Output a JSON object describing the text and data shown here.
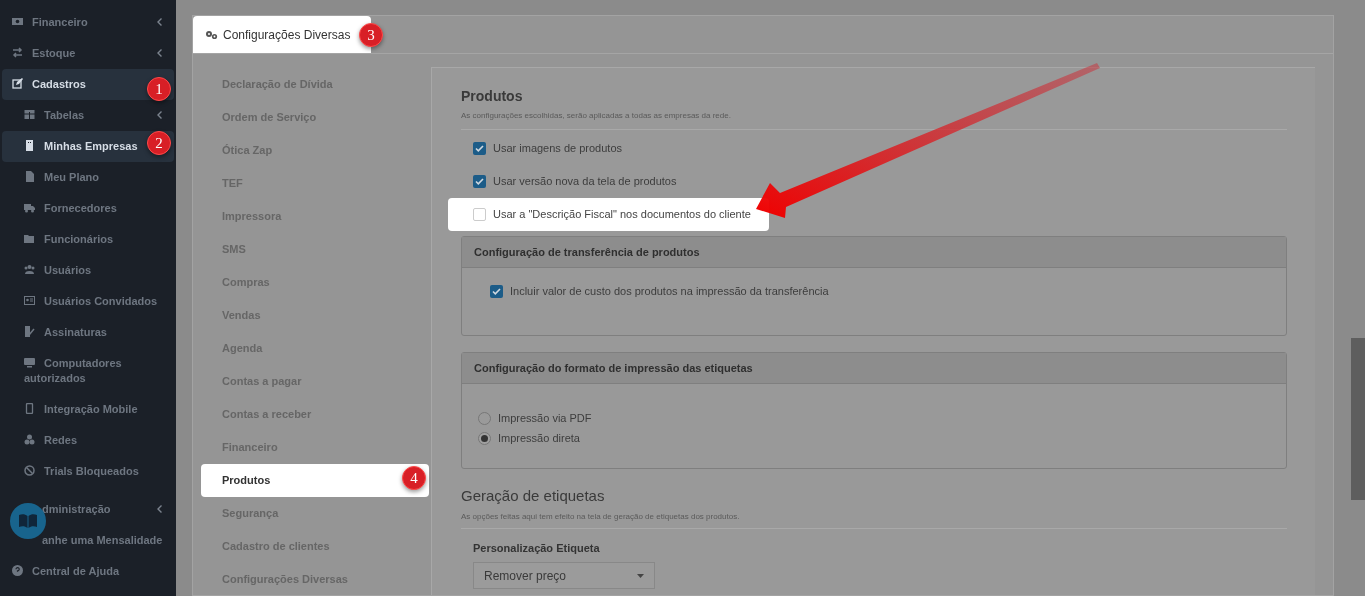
{
  "sidebar": {
    "items": [
      {
        "label": "Financeiro",
        "chevron": true,
        "selected": false
      },
      {
        "label": "Estoque",
        "chevron": true,
        "selected": false
      },
      {
        "label": "Cadastros",
        "chevron": false,
        "selected": true,
        "children": [
          {
            "label": "Tabelas",
            "chevron": true,
            "selected": false
          },
          {
            "label": "Minhas Empresas",
            "chevron": false,
            "selected": true
          },
          {
            "label": "Meu Plano",
            "chevron": false,
            "selected": false
          },
          {
            "label": "Fornecedores",
            "chevron": false,
            "selected": false
          },
          {
            "label": "Funcionários",
            "chevron": false,
            "selected": false
          },
          {
            "label": "Usuários",
            "chevron": false,
            "selected": false
          },
          {
            "label": "Usuários Convidados",
            "chevron": false,
            "selected": false
          },
          {
            "label": "Assinaturas",
            "chevron": false,
            "selected": false
          },
          {
            "label": "Computadores autorizados",
            "chevron": false,
            "selected": false
          },
          {
            "label": "Integração Mobile",
            "chevron": false,
            "selected": false
          },
          {
            "label": "Redes",
            "chevron": false,
            "selected": false
          },
          {
            "label": "Trials Bloqueados",
            "chevron": false,
            "selected": false
          }
        ]
      },
      {
        "label": "dministração",
        "chevron": true,
        "selected": false
      },
      {
        "label": "anhe uma Mensalidade",
        "chevron": false,
        "selected": false
      },
      {
        "label": "Central de Ajuda",
        "chevron": false,
        "selected": false
      }
    ]
  },
  "tab": {
    "label": "Configurações Diversas"
  },
  "settings_nav": {
    "items": [
      {
        "label": "Declaração de Dívida",
        "selected": false
      },
      {
        "label": "Ordem de Serviço",
        "selected": false
      },
      {
        "label": "Ótica Zap",
        "selected": false
      },
      {
        "label": "TEF",
        "selected": false
      },
      {
        "label": "Impressora",
        "selected": false
      },
      {
        "label": "SMS",
        "selected": false
      },
      {
        "label": "Compras",
        "selected": false
      },
      {
        "label": "Vendas",
        "selected": false
      },
      {
        "label": "Agenda",
        "selected": false
      },
      {
        "label": "Contas a pagar",
        "selected": false
      },
      {
        "label": "Contas a receber",
        "selected": false
      },
      {
        "label": "Financeiro",
        "selected": false
      },
      {
        "label": "Produtos",
        "selected": true
      },
      {
        "label": "Segurança",
        "selected": false
      },
      {
        "label": "Cadastro de clientes",
        "selected": false
      },
      {
        "label": "Configurações Diversas",
        "selected": false
      }
    ]
  },
  "products": {
    "title": "Produtos",
    "subtitle": "As configurações escolhidas, serão aplicadas a todas as empresas da rede.",
    "options": [
      {
        "label": "Usar imagens de produtos",
        "checked": true,
        "highlighted": false
      },
      {
        "label": "Usar versão nova da tela de produtos",
        "checked": true,
        "highlighted": false
      },
      {
        "label": "Usar a \"Descrição Fiscal\" nos documentos do cliente",
        "checked": false,
        "highlighted": true
      }
    ],
    "transfer_group": {
      "title": "Configuração de transferência de produtos",
      "options": [
        {
          "label": "Incluir valor de custo dos produtos na impressão da transferência",
          "checked": true
        }
      ]
    },
    "label_format_group": {
      "title": "Configuração do formato de impressão das etiquetas",
      "options": [
        {
          "label": "Impressão via PDF",
          "selected": false
        },
        {
          "label": "Impressão direta",
          "selected": true
        }
      ]
    }
  },
  "label_generation": {
    "title": "Geração de etiquetas",
    "subtitle": "As opções feitas aqui tem efeito na tela de geração de etiquetas dos produtos.",
    "field_label": "Personalização Etiqueta",
    "select_value": "Remover preço"
  },
  "badges": [
    {
      "number": "1"
    },
    {
      "number": "2"
    },
    {
      "number": "3"
    },
    {
      "number": "4"
    }
  ]
}
